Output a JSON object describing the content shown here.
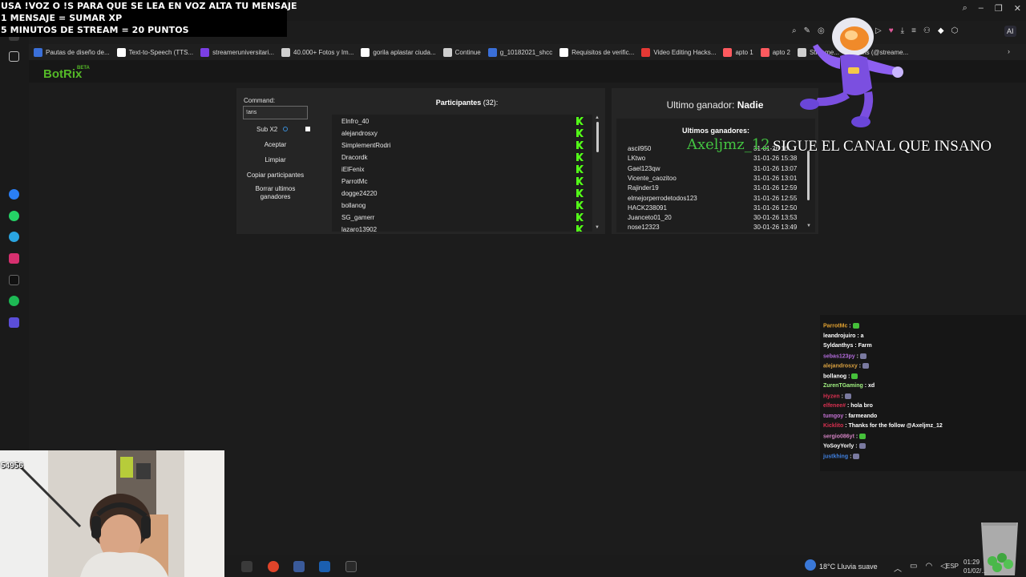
{
  "overlay": {
    "line1": "USA !VOZ O !S PARA QUE SE LEA EN VOZ ALTA TU MENSAJE",
    "line2": "1 MENSAJE = SUMAR XP",
    "line3": "5 MINUTOS DE STREAM = 20 PUNTOS"
  },
  "browser": {
    "bookmarks": [
      {
        "label": "Pautas de diseño de...",
        "color": "#3a6fd8"
      },
      {
        "label": "Text-to-Speech (TTS...",
        "color": "#ffffff"
      },
      {
        "label": "streameruniversitari...",
        "color": "#7b3fe4"
      },
      {
        "label": "40.000+ Fotos y Im...",
        "color": "#cfcfcf"
      },
      {
        "label": "gorila aplastar ciuda...",
        "color": "#ffffff"
      },
      {
        "label": "Continue",
        "color": "#cfcfcf"
      },
      {
        "label": "g_10182021_shcc",
        "color": "#3a6fd8"
      },
      {
        "label": "Requisitos de verific...",
        "color": "#ffffff"
      },
      {
        "label": "Video Editing Hacks...",
        "color": "#e53935"
      },
      {
        "label": "apto 1",
        "color": "#ff5a5f"
      },
      {
        "label": "apto 2",
        "color": "#ff5a5f"
      },
      {
        "label": "Streame...",
        "color": "#cfcfcf"
      },
      {
        "label": "Aris (@streame...",
        "color": "#cfcfcf"
      }
    ],
    "ai_label": "AI"
  },
  "app": {
    "logo": "BotRix",
    "beta": "BETA",
    "command_label": "Command:",
    "command_value": "!aris",
    "sub_label": "Sub X2",
    "buttons": {
      "accept": "Aceptar",
      "clear": "Limpiar",
      "copy": "Copiar participantes",
      "delete_winners": "Borrar ultimos ganadores"
    },
    "participants_title": "Participantes",
    "participants_count": "(32):",
    "participants": [
      "Elnfro_40",
      "alejandrosxy",
      "SimplementRodri",
      "Dracordk",
      "iElFenix",
      "ParrotMc",
      "dogge24220",
      "bollanog",
      "SG_gamerr",
      "lazaro13902"
    ],
    "last_winner_label": "Ultimo ganador:",
    "last_winner_value": "Nadie",
    "winners_title": "Ultimos ganadores:",
    "winners": [
      {
        "name": "ascil950",
        "date": "31-01-26 16:..."
      },
      {
        "name": "LKtwo",
        "date": "31-01-26 15:38"
      },
      {
        "name": "Gael123qw",
        "date": "31-01-26 13:07"
      },
      {
        "name": "Vicente_caozitoo",
        "date": "31-01-26 13:01"
      },
      {
        "name": "Rajinder19",
        "date": "31-01-26 12:59"
      },
      {
        "name": "elmejorperrodetodos123",
        "date": "31-01-26 12:55"
      },
      {
        "name": "HACK238091",
        "date": "31-01-26 12:50"
      },
      {
        "name": "Juanceto01_20",
        "date": "30-01-26 13:53"
      },
      {
        "name": "nose12323",
        "date": "30-01-26 13:49"
      }
    ]
  },
  "banner": {
    "name": "Axeljmz_12",
    "text": "SIGUE EL CANAL QUE INSANO"
  },
  "chat": [
    {
      "user": "ParrotMc",
      "color": "#e0a030",
      "msg": ":",
      "emote": "#45c03a"
    },
    {
      "user": "leandrojuiro",
      "color": "#ffffff",
      "msg": ": a",
      "emote": ""
    },
    {
      "user": "Syldanthys",
      "color": "#ffffff",
      "msg": ": Farm",
      "emote": ""
    },
    {
      "user": "sebas123py",
      "color": "#b06ad8",
      "msg": ":",
      "emote": "#7a7aa0"
    },
    {
      "user": "alejandrosxy",
      "color": "#d8a040",
      "msg": ":",
      "emote": "#7a7aa0"
    },
    {
      "user": "bollanog",
      "color": "#ffffff",
      "msg": ":",
      "emote": "#45c03a"
    },
    {
      "user": "ZurenTGaming",
      "color": "#a0f080",
      "msg": ": xd",
      "emote": ""
    },
    {
      "user": "Hyzen",
      "color": "#d83050",
      "msg": ":",
      "emote": "#7a7aa0"
    },
    {
      "user": "elfenee#",
      "color": "#d83050",
      "msg": ": hola bro",
      "emote": ""
    },
    {
      "user": "tumgoy",
      "color": "#c070d0",
      "msg": ": farmeando",
      "emote": ""
    },
    {
      "user": "Kicklito",
      "color": "#d83050",
      "msg": ": Thanks for the follow @Axeljmz_12",
      "emote": ""
    },
    {
      "user": "sergio086yt",
      "color": "#d080c0",
      "msg": ":",
      "emote": "#45c03a"
    },
    {
      "user": "YoSoyYorly",
      "color": "#ffffff",
      "msg": ":",
      "emote": "#7a7aa0"
    },
    {
      "user": "justkhing",
      "color": "#4080e0",
      "msg": ":",
      "emote": "#7a7aa0"
    }
  ],
  "webcam": {
    "counter": "54956"
  },
  "taskbar": {
    "weather": "18°C  Lluvia suave",
    "lang": "ESP",
    "time": "01:29",
    "date": "01/02/..."
  }
}
